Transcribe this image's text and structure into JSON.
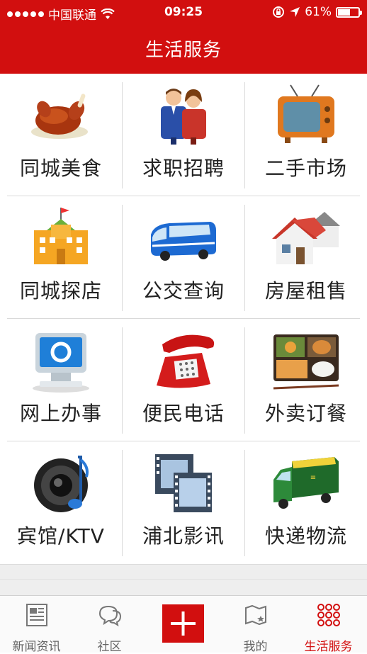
{
  "status_bar": {
    "carrier": "中国联通",
    "time": "09:25",
    "battery_text": "61%",
    "battery_level": 0.61
  },
  "header": {
    "title": "生活服务"
  },
  "services": [
    {
      "label": "同城美食",
      "icon": "roast-chicken-icon"
    },
    {
      "label": "求职招聘",
      "icon": "job-seekers-icon"
    },
    {
      "label": "二手市场",
      "icon": "retro-tv-icon"
    },
    {
      "label": "同城探店",
      "icon": "building-icon"
    },
    {
      "label": "公交查询",
      "icon": "bus-icon"
    },
    {
      "label": "房屋租售",
      "icon": "houses-icon"
    },
    {
      "label": "网上办事",
      "icon": "computer-monitor-icon"
    },
    {
      "label": "便民电话",
      "icon": "telephone-icon"
    },
    {
      "label": "外卖订餐",
      "icon": "bento-meal-icon"
    },
    {
      "label": "宾馆/KTV",
      "icon": "speaker-icon"
    },
    {
      "label": "浦北影讯",
      "icon": "film-strip-icon"
    },
    {
      "label": "快递物流",
      "icon": "delivery-van-icon"
    }
  ],
  "tabs": [
    {
      "label": "新闻资讯",
      "icon": "newspaper-icon"
    },
    {
      "label": "社区",
      "icon": "chat-bubbles-icon"
    },
    {
      "label": "",
      "icon": "plus-icon"
    },
    {
      "label": "我的",
      "icon": "map-icon"
    },
    {
      "label": "生活服务",
      "icon": "grid-dots-icon",
      "active": true
    }
  ],
  "colors": {
    "brand_red": "#d20f0f",
    "separator": "#d9d9d9"
  }
}
